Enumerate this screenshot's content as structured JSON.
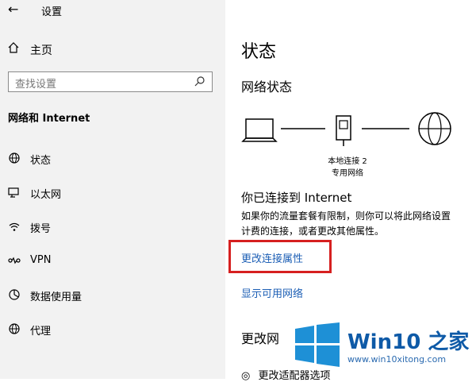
{
  "window": {
    "title": "设置"
  },
  "sidebar": {
    "home_label": "主页",
    "search_placeholder": "查找设置",
    "section_title": "网络和 Internet",
    "items": [
      {
        "label": "状态",
        "icon": "globe-status-icon"
      },
      {
        "label": "以太网",
        "icon": "ethernet-icon"
      },
      {
        "label": "拨号",
        "icon": "dialup-icon"
      },
      {
        "label": "VPN",
        "icon": "vpn-icon"
      },
      {
        "label": "数据使用量",
        "icon": "data-usage-icon"
      },
      {
        "label": "代理",
        "icon": "globe-proxy-icon"
      }
    ]
  },
  "main": {
    "title": "状态",
    "network_status_heading": "网络状态",
    "adapter_name": "本地连接 2",
    "network_type": "专用网络",
    "connected_heading": "你已连接到 Internet",
    "description_line1": "如果你的流量套餐有限制，则你可以将此网络设置",
    "description_line2": "计费的连接，或者更改其他属性。",
    "link_change_properties": "更改连接属性",
    "link_show_networks": "显示可用网络",
    "change_section_heading": "更改网",
    "partial_option": "更改适配器选项"
  },
  "watermark": {
    "brand": "Win10 之家",
    "url": "www.win10xitong.com"
  },
  "colors": {
    "link": "#1d5fb5",
    "highlight_border": "#d62020",
    "sidebar_bg": "#f2f2f2"
  }
}
